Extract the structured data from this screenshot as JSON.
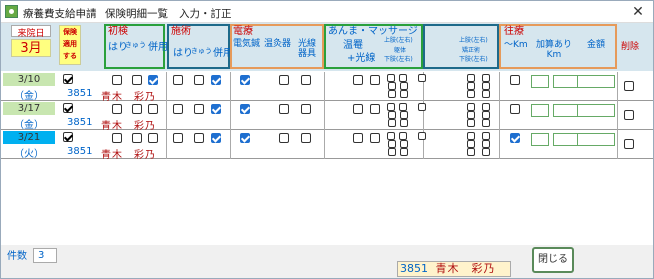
{
  "window": {
    "title_parts": [
      "療養費支給申請",
      "保険明細一覧",
      "入力・訂正"
    ],
    "close_glyph": "✕"
  },
  "header": {
    "visit_date_label": "来院日",
    "visit_month": "3月",
    "insurance_apply_label": [
      "保険",
      "適用",
      "する"
    ],
    "shoken": {
      "title": "初検",
      "cols": [
        "はり",
        "きゅう",
        "併用"
      ]
    },
    "sejutsu": {
      "title": "施術",
      "cols": [
        "はり",
        "きゅう",
        "併用"
      ]
    },
    "denryo": {
      "title": "電療",
      "cols": [
        "電気鍼",
        "温灸器",
        "光線器具"
      ]
    },
    "anma": {
      "title": "あんま・マッサージ",
      "sub1": "温罨",
      "sub2": "+光線",
      "note1": "上肢(左右)",
      "note2": "躯体",
      "note3": "下肢(左右)"
    },
    "hena": {
      "note1": "上肢(左右)",
      "note2": "矯正術",
      "note3": "下肢(左右)"
    },
    "oryo": {
      "title": "往療",
      "cols": [
        "～Km",
        "加算あり Km",
        "金額"
      ]
    },
    "delete_label": "削除"
  },
  "rows": [
    {
      "date": "3/10",
      "dow": "（金）",
      "patient_id": "3851",
      "patient_name": "青木　彩乃",
      "highlight": "#c8e6b0"
    },
    {
      "date": "3/17",
      "dow": "（金）",
      "patient_id": "3851",
      "patient_name": "青木　彩乃",
      "highlight": "#c8e6b0"
    },
    {
      "date": "3/21",
      "dow": "（火）",
      "patient_id": "3851",
      "patient_name": "青木　彩乃",
      "highlight": "#00b0f0"
    }
  ],
  "footer": {
    "count_label": "件数",
    "count_value": "3",
    "selected_id": "3851",
    "selected_name": "青木　彩乃",
    "close_button": "閉じる"
  }
}
